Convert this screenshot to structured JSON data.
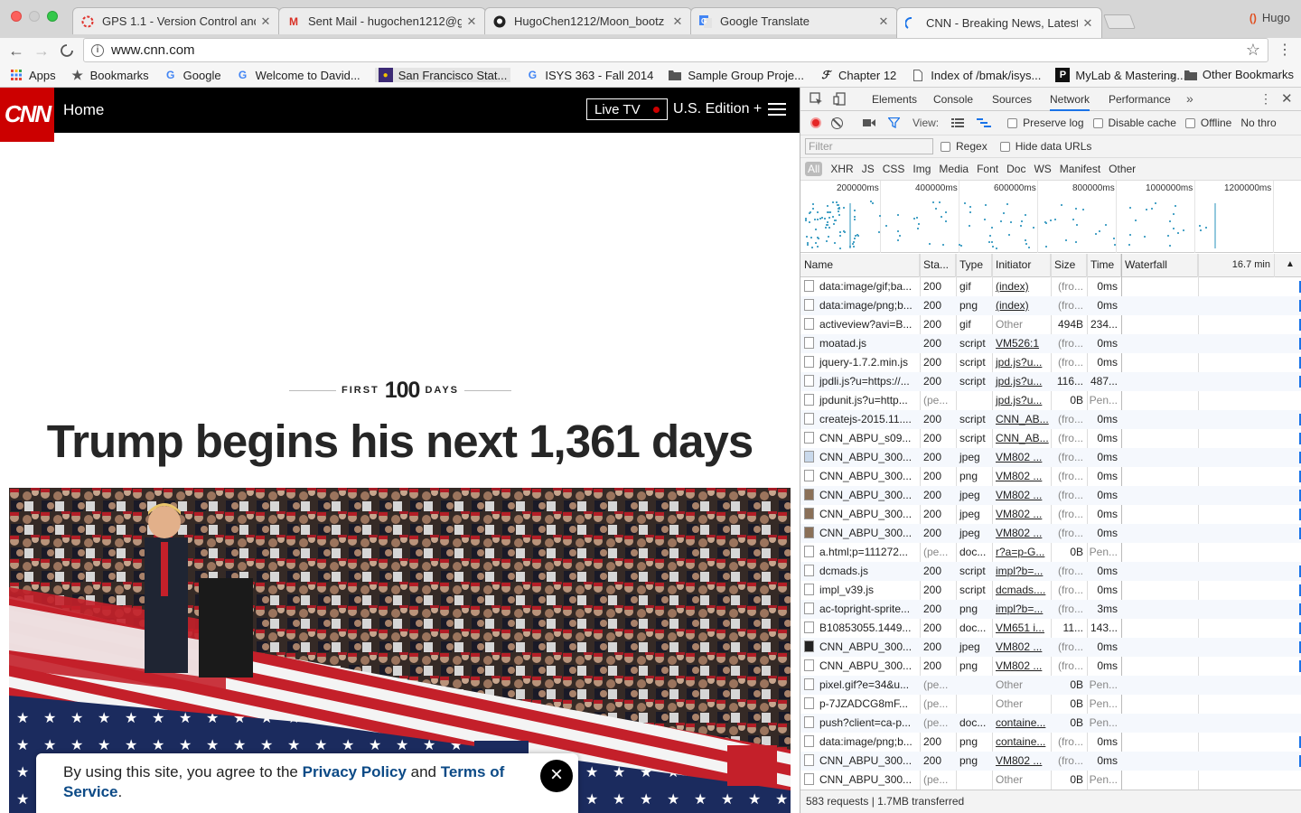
{
  "browser": {
    "tabs": [
      {
        "title": "GPS 1.1 - Version Control and",
        "icon": "gps-icon"
      },
      {
        "title": "Sent Mail - hugochen1212@g",
        "icon": "gmail-icon"
      },
      {
        "title": "HugoChen1212/Moon_bootz",
        "icon": "github-icon"
      },
      {
        "title": "Google Translate",
        "icon": "google-translate-icon"
      },
      {
        "title": "CNN - Breaking News, Latest",
        "icon": "loading-spinner-icon"
      }
    ],
    "profile_name": "Hugo",
    "url": "www.cnn.com",
    "bookmarks": [
      {
        "label": "Apps",
        "icon": "apps-grid-icon"
      },
      {
        "label": "Bookmarks",
        "icon": "star-icon"
      },
      {
        "label": "Google",
        "icon": "google-icon"
      },
      {
        "label": "Welcome to David...",
        "icon": "google-icon"
      },
      {
        "label": "San Francisco Stat...",
        "icon": "sfsu-icon"
      },
      {
        "label": "ISYS 363 - Fall 2014",
        "icon": "google-icon"
      },
      {
        "label": "Sample Group Proje...",
        "icon": "folder-icon"
      },
      {
        "label": "Chapter 12",
        "icon": "chapter-icon"
      },
      {
        "label": "Index of /bmak/isys...",
        "icon": "page-icon"
      },
      {
        "label": "MyLab & Mastering...",
        "icon": "pearson-icon"
      }
    ],
    "bookmarks_overflow": "»",
    "other_bookmarks": "Other Bookmarks"
  },
  "cnn": {
    "logo": "CNN",
    "home": "Home",
    "live_tv": "Live TV",
    "edition": "U.S. Edition +",
    "kicker_first": "FIRST",
    "kicker_number": "100",
    "kicker_days": "DAYS",
    "headline": "Trump begins his next 1,361 days",
    "consent_prefix": "By using this site, you agree to the ",
    "consent_privacy": "Privacy Policy",
    "consent_and": " and ",
    "consent_terms": "Terms of Service",
    "consent_end": ".",
    "consent_close": "×"
  },
  "devtools": {
    "tabs": [
      "Elements",
      "Console",
      "Sources",
      "Network",
      "Performance"
    ],
    "active_tab": "Network",
    "more": "»",
    "view_label": "View:",
    "preserve_log": "Preserve log",
    "disable_cache": "Disable cache",
    "offline": "Offline",
    "throttle": "No thro",
    "filter_placeholder": "Filter",
    "regex": "Regex",
    "hide_data_urls": "Hide data URLs",
    "resource_types": [
      "All",
      "XHR",
      "JS",
      "CSS",
      "Img",
      "Media",
      "Font",
      "Doc",
      "WS",
      "Manifest",
      "Other"
    ],
    "timeline_labels": [
      "200000ms",
      "400000ms",
      "600000ms",
      "800000ms",
      "1000000ms",
      "1200000ms"
    ],
    "columns": {
      "name": "Name",
      "status": "Sta...",
      "type": "Type",
      "initiator": "Initiator",
      "size": "Size",
      "time": "Time",
      "waterfall": "Waterfall",
      "waterfall_scale": "16.7 min"
    },
    "sort_arrow": "▲",
    "rows": [
      {
        "name": "data:image/gif;ba...",
        "status": "200",
        "type": "gif",
        "initiator": "(index)",
        "size": "(fro...",
        "time": "0ms",
        "icon": "file"
      },
      {
        "name": "data:image/png;b...",
        "status": "200",
        "type": "png",
        "initiator": "(index)",
        "size": "(fro...",
        "time": "0ms",
        "icon": "file"
      },
      {
        "name": "activeview?avi=B...",
        "status": "200",
        "type": "gif",
        "initiator": "Other",
        "size": "494B",
        "time": "234...",
        "icon": "file"
      },
      {
        "name": "moatad.js",
        "status": "200",
        "type": "script",
        "initiator": "VM526:1",
        "size": "(fro...",
        "time": "0ms",
        "icon": "file"
      },
      {
        "name": "jquery-1.7.2.min.js",
        "status": "200",
        "type": "script",
        "initiator": "jpd.js?u...",
        "size": "(fro...",
        "time": "0ms",
        "icon": "file"
      },
      {
        "name": "jpdli.js?u=https://...",
        "status": "200",
        "type": "script",
        "initiator": "jpd.js?u...",
        "size": "116...",
        "time": "487...",
        "icon": "file"
      },
      {
        "name": "jpdunit.js?u=http...",
        "status": "(pe...",
        "type": "",
        "initiator": "jpd.js?u...",
        "size": "0B",
        "time": "Pen...",
        "icon": "file"
      },
      {
        "name": "createjs-2015.11....",
        "status": "200",
        "type": "script",
        "initiator": "CNN_AB...",
        "size": "(fro...",
        "time": "0ms",
        "icon": "file"
      },
      {
        "name": "CNN_ABPU_s09...",
        "status": "200",
        "type": "script",
        "initiator": "CNN_AB...",
        "size": "(fro...",
        "time": "0ms",
        "icon": "file"
      },
      {
        "name": "CNN_ABPU_300...",
        "status": "200",
        "type": "jpeg",
        "initiator": "VM802 ...",
        "size": "(fro...",
        "time": "0ms",
        "icon": "img"
      },
      {
        "name": "CNN_ABPU_300...",
        "status": "200",
        "type": "png",
        "initiator": "VM802 ...",
        "size": "(fro...",
        "time": "0ms",
        "icon": "file"
      },
      {
        "name": "CNN_ABPU_300...",
        "status": "200",
        "type": "jpeg",
        "initiator": "VM802 ...",
        "size": "(fro...",
        "time": "0ms",
        "icon": "photo"
      },
      {
        "name": "CNN_ABPU_300...",
        "status": "200",
        "type": "jpeg",
        "initiator": "VM802 ...",
        "size": "(fro...",
        "time": "0ms",
        "icon": "photo"
      },
      {
        "name": "CNN_ABPU_300...",
        "status": "200",
        "type": "jpeg",
        "initiator": "VM802 ...",
        "size": "(fro...",
        "time": "0ms",
        "icon": "photo"
      },
      {
        "name": "a.html;p=111272...",
        "status": "(pe...",
        "type": "doc...",
        "initiator": "r?a=p-G...",
        "size": "0B",
        "time": "Pen...",
        "icon": "file"
      },
      {
        "name": "dcmads.js",
        "status": "200",
        "type": "script",
        "initiator": "impl?b=...",
        "size": "(fro...",
        "time": "0ms",
        "icon": "file"
      },
      {
        "name": "impl_v39.js",
        "status": "200",
        "type": "script",
        "initiator": "dcmads....",
        "size": "(fro...",
        "time": "0ms",
        "icon": "file"
      },
      {
        "name": "ac-topright-sprite...",
        "status": "200",
        "type": "png",
        "initiator": "impl?b=...",
        "size": "(fro...",
        "time": "3ms",
        "icon": "file"
      },
      {
        "name": "B10853055.1449...",
        "status": "200",
        "type": "doc...",
        "initiator": "VM651 i...",
        "size": "11...",
        "time": "143...",
        "icon": "file"
      },
      {
        "name": "CNN_ABPU_300...",
        "status": "200",
        "type": "jpeg",
        "initiator": "VM802 ...",
        "size": "(fro...",
        "time": "0ms",
        "icon": "dark"
      },
      {
        "name": "CNN_ABPU_300...",
        "status": "200",
        "type": "png",
        "initiator": "VM802 ...",
        "size": "(fro...",
        "time": "0ms",
        "icon": "file"
      },
      {
        "name": "pixel.gif?e=34&u...",
        "status": "(pe...",
        "type": "",
        "initiator": "Other",
        "size": "0B",
        "time": "Pen...",
        "icon": "file"
      },
      {
        "name": "p-7JZADCG8mF...",
        "status": "(pe...",
        "type": "",
        "initiator": "Other",
        "size": "0B",
        "time": "Pen...",
        "icon": "file"
      },
      {
        "name": "push?client=ca-p...",
        "status": "(pe...",
        "type": "doc...",
        "initiator": "containe...",
        "size": "0B",
        "time": "Pen...",
        "icon": "file"
      },
      {
        "name": "data:image/png;b...",
        "status": "200",
        "type": "png",
        "initiator": "containe...",
        "size": "(fro...",
        "time": "0ms",
        "icon": "file"
      },
      {
        "name": "CNN_ABPU_300...",
        "status": "200",
        "type": "png",
        "initiator": "VM802 ...",
        "size": "(fro...",
        "time": "0ms",
        "icon": "file"
      },
      {
        "name": "CNN_ABPU_300...",
        "status": "(pe...",
        "type": "",
        "initiator": "Other",
        "size": "0B",
        "time": "Pen...",
        "icon": "file"
      }
    ],
    "summary": "583 requests | 1.7MB transferred"
  },
  "colors": {
    "cnn_red": "#cc0000",
    "devtools_blue": "#1a73e8",
    "record_red": "#e52525",
    "link_blue": "#0c4a86"
  }
}
